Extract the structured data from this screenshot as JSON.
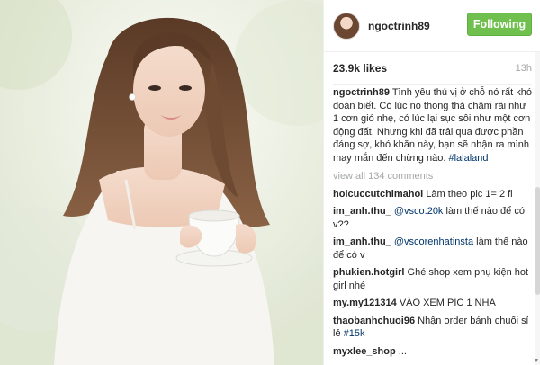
{
  "post": {
    "username": "ngoctrinh89",
    "follow_label": "Following",
    "likes": "23.9k likes",
    "time": "13h",
    "caption": {
      "user": "ngoctrinh89",
      "text": "Tình yêu thú vị ở chỗ nó rất khó đoán biết. Có lúc nó thong thả chậm rãi như 1 cơn gió nhẹ, có lúc lại sục sôi như một cơn động đất. Nhưng khi đã trải qua được phần đáng sợ, khó khăn này, bạn sẽ nhận ra mình may mắn đến chừng nào.",
      "tag": "#lalaland"
    },
    "view_all": "view all 134 comments",
    "comments": [
      {
        "user": "hoicuccutchimahoi",
        "pre": "",
        "mention": "",
        "text": "Làm theo pic 1= 2 fl"
      },
      {
        "user": "im_anh.thu_",
        "pre": "",
        "mention": "@vsco.20k",
        "text": "làm thế nào để có v??"
      },
      {
        "user": "im_anh.thu_",
        "pre": "",
        "mention": "@vscorenhatinsta",
        "text": "làm thế nào để có v"
      },
      {
        "user": "phukien.hotgirl",
        "pre": "",
        "mention": "",
        "text": "Ghé shop xem phụ kiện hot girl nhé"
      },
      {
        "user": "my.my121314",
        "pre": "",
        "mention": "",
        "text": "VÀO XEM PIC 1 NHA"
      },
      {
        "user": "thaobanhchuoi96",
        "pre": "Nhận order bánh chuối sỉ lẻ",
        "mention": "#15k",
        "text": ""
      },
      {
        "user": "myxlee_shop",
        "pre": "",
        "mention": "",
        "text": "..."
      }
    ]
  }
}
